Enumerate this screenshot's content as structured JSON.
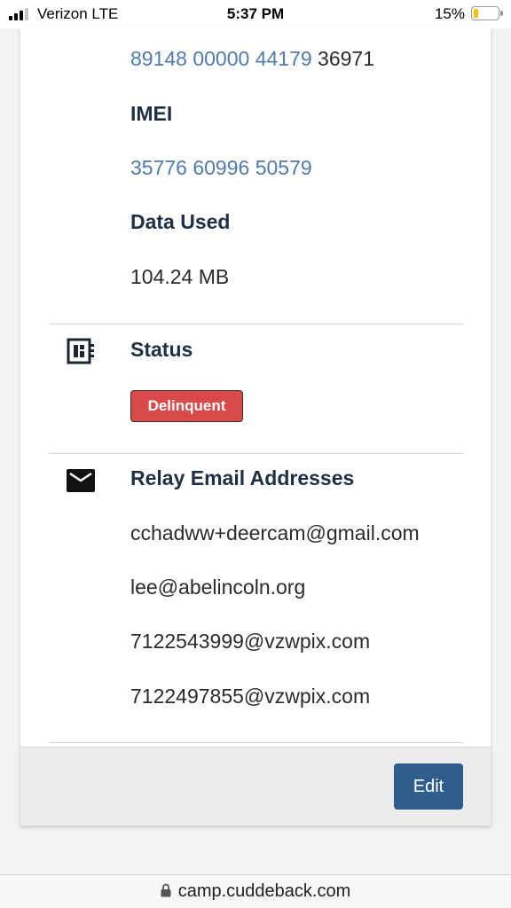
{
  "status_bar": {
    "carrier": "Verizon  LTE",
    "time": "5:37 PM",
    "battery": "15%",
    "battery_level": 0.15
  },
  "device": {
    "iccid_link_part": "89148 00000 44179",
    "iccid_rest": "36971",
    "imei_label": "IMEI",
    "imei_value": "35776 60996 50579",
    "data_used_label": "Data Used",
    "data_used_value": "104.24 MB"
  },
  "status": {
    "label": "Status",
    "badge": "Delinquent",
    "badge_color": "#d94b4b",
    "icon": "dashboard-icon"
  },
  "relay": {
    "label": "Relay Email Addresses",
    "icon": "mail-icon",
    "emails": [
      "cchadww+deercam@gmail.com",
      "lee@abelincoln.org",
      "7122543999@vzwpix.com",
      "7122497855@vzwpix.com"
    ]
  },
  "footer": {
    "edit_label": "Edit",
    "accent": "#2f5d8c"
  },
  "browser": {
    "url": "camp.cuddeback.com",
    "link_color": "#4f7bad"
  }
}
